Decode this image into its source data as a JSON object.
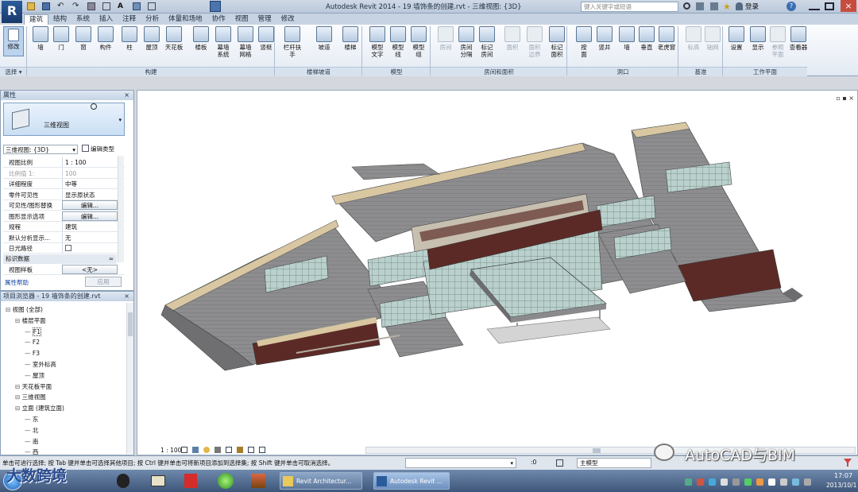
{
  "titlebar": {
    "title": "Autodesk Revit 2014 -   19 墙饰条的创建.rvt - 三维视图: {3D}",
    "search_placeholder": "键入关键字或短语",
    "signin_label": "登录"
  },
  "app_logo": "R",
  "ribbon_tabs": [
    "建筑",
    "结构",
    "系统",
    "插入",
    "注释",
    "分析",
    "体量和场地",
    "协作",
    "视图",
    "管理",
    "修改"
  ],
  "ribbon": {
    "modify": "修改",
    "select_panel": "选择",
    "buttons": [
      {
        "label": "墙"
      },
      {
        "label": "门"
      },
      {
        "label": "窗"
      },
      {
        "label": "构件"
      },
      {
        "label": "柱"
      },
      {
        "label": "屋顶"
      },
      {
        "label": "天花板"
      },
      {
        "label": "楼板"
      },
      {
        "label": "幕墙\n系统"
      },
      {
        "label": "幕墙\n网格"
      },
      {
        "label": "竖梃"
      },
      {
        "label": "栏杆扶手"
      },
      {
        "label": "坡道"
      },
      {
        "label": "楼梯"
      },
      {
        "label": "模型\n文字"
      },
      {
        "label": "模型\n线"
      },
      {
        "label": "模型\n组"
      },
      {
        "label": "房间"
      },
      {
        "label": "房间\n分隔"
      },
      {
        "label": "标记\n房间"
      },
      {
        "label": "面积"
      },
      {
        "label": "面积\n边界"
      },
      {
        "label": "标记\n面积"
      },
      {
        "label": "按\n面"
      },
      {
        "label": "竖井"
      },
      {
        "label": "墙"
      },
      {
        "label": "垂直"
      },
      {
        "label": "老虎窗"
      },
      {
        "label": "标高"
      },
      {
        "label": "轴网"
      },
      {
        "label": "设置"
      },
      {
        "label": "显示"
      },
      {
        "label": "参照\n平面"
      },
      {
        "label": "查看器"
      }
    ],
    "panels": [
      "构建",
      "楼梯坡道",
      "模型",
      "房间和面积",
      "洞口",
      "基准",
      "工作平面"
    ]
  },
  "properties": {
    "header": "属性",
    "type_name": "三维视图",
    "view_selector": "三维视图: {3D}",
    "edit_type": "编辑类型",
    "rows": [
      {
        "k": "视图比例",
        "v": "1 : 100"
      },
      {
        "k": "比例值 1:",
        "v": "100"
      },
      {
        "k": "详细程度",
        "v": "中等"
      },
      {
        "k": "零件可见性",
        "v": "显示原状态"
      },
      {
        "k": "可见性/图形替换",
        "v": "编辑..."
      },
      {
        "k": "图形显示选项",
        "v": "编辑..."
      },
      {
        "k": "规程",
        "v": "建筑"
      },
      {
        "k": "默认分析显示...",
        "v": "无"
      },
      {
        "k": "日光路径",
        "v": ""
      }
    ],
    "section_identity": "标识数据",
    "view_template_k": "视图样板",
    "view_template_v": "<无>",
    "help_link": "属性帮助",
    "apply_button": "应用"
  },
  "project_browser": {
    "header": "项目浏览器 - 19 墙饰条的创建.rvt",
    "items": [
      {
        "label": "视图 (全部)",
        "level": 0
      },
      {
        "label": "楼层平面",
        "level": 1
      },
      {
        "label": "F1",
        "level": 2
      },
      {
        "label": "F2",
        "level": 2
      },
      {
        "label": "F3",
        "level": 2
      },
      {
        "label": "室外标高",
        "level": 2
      },
      {
        "label": "屋顶",
        "level": 2
      },
      {
        "label": "天花板平面",
        "level": 1
      },
      {
        "label": "三维视图",
        "level": 1
      },
      {
        "label": "立面 (建筑立面)",
        "level": 1
      },
      {
        "label": "东",
        "level": 2
      },
      {
        "label": "北",
        "level": 2
      },
      {
        "label": "南",
        "level": 2
      },
      {
        "label": "西",
        "level": 2
      }
    ]
  },
  "viewport": {
    "scale": "1 : 100"
  },
  "status": {
    "hint": "单击可进行选择; 按 Tab 键并单击可选择其他项目; 按 Ctrl 键并单击可将新项目添加到选择集; 按 Shift 键并单击可取消选择。",
    "coord": ":0",
    "model_label": "主模型"
  },
  "watermark": {
    "left": "大数跨境",
    "right": "AutoCAD与BIM"
  },
  "taskbar": {
    "items": [
      "Revit Architectur...",
      "Autodesk Revit ..."
    ],
    "time": "17:07",
    "date": "2013/10/1"
  }
}
